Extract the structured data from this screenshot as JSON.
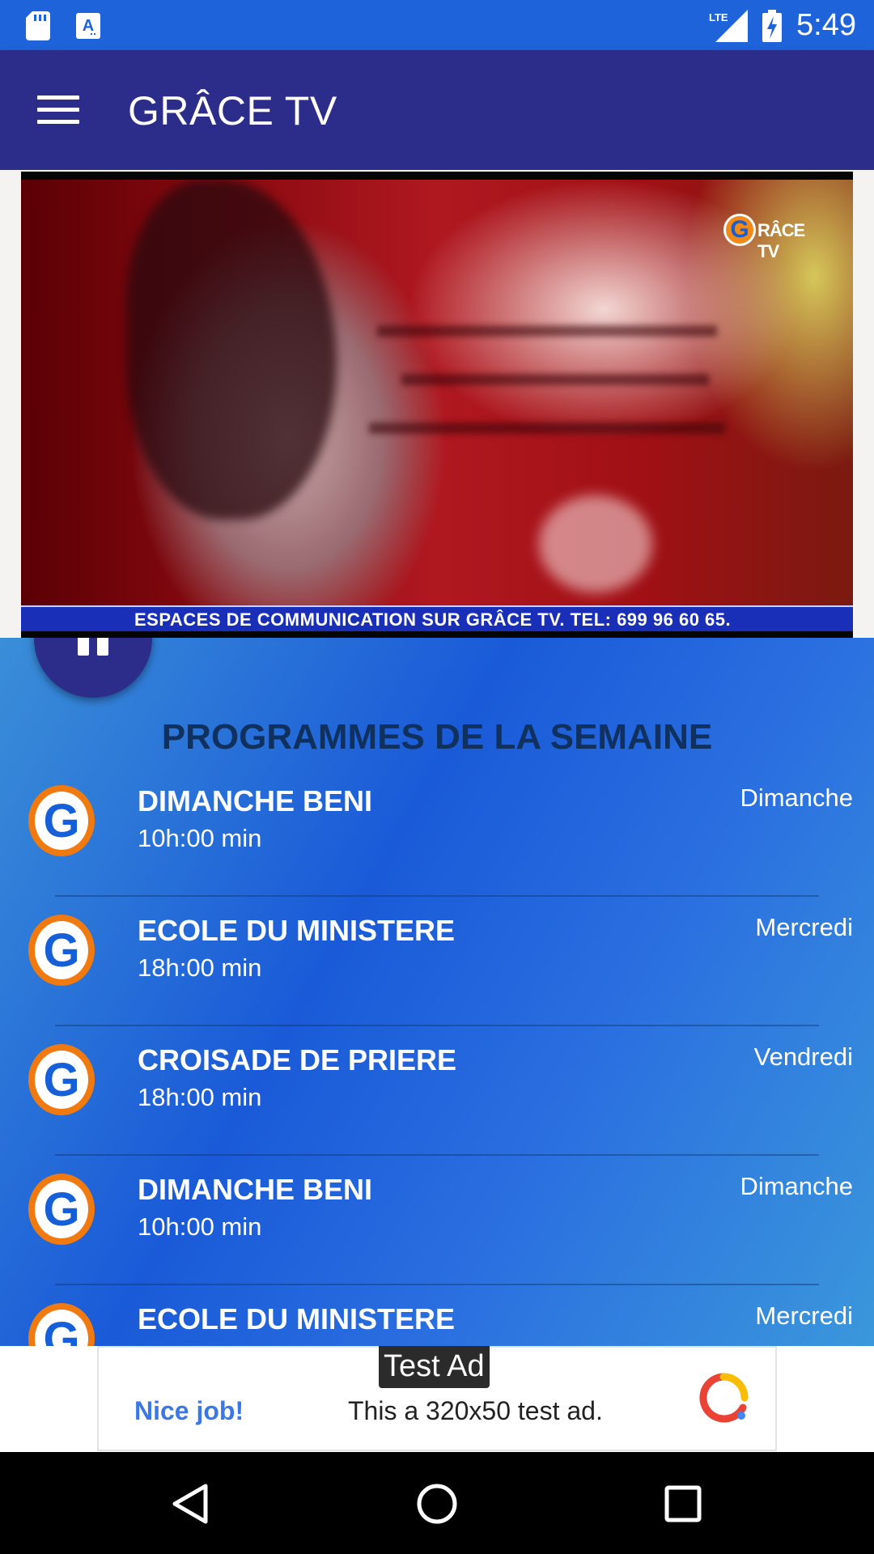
{
  "status_bar": {
    "time": "5:49",
    "network": "LTE",
    "icons": [
      "sd-card-icon",
      "a-notification-icon",
      "lte-signal-icon",
      "battery-charging-icon"
    ]
  },
  "app_bar": {
    "title": "GRÂCE TV",
    "menu_icon": "hamburger-menu-icon"
  },
  "player": {
    "channel_logo_text": "RÂCE TV",
    "ticker_text": "ESPACES DE COMMUNICATION SUR GRÂCE TV. TEL: 699 96 60 65.",
    "state": "playing",
    "control_icon": "pause-icon"
  },
  "programs": {
    "title": "PROGRAMMES DE LA SEMAINE",
    "items": [
      {
        "name": "DIMANCHE BENI",
        "time": "10h:00 min",
        "day": "Dimanche"
      },
      {
        "name": "ECOLE DU MINISTERE",
        "time": "18h:00 min",
        "day": "Mercredi"
      },
      {
        "name": "CROISADE DE PRIERE",
        "time": "18h:00 min",
        "day": "Vendredi"
      },
      {
        "name": "DIMANCHE BENI",
        "time": "10h:00 min",
        "day": "Dimanche"
      },
      {
        "name": "ECOLE DU MINISTERE",
        "time": "",
        "day": "Mercredi"
      }
    ]
  },
  "ad": {
    "label": "Test Ad",
    "headline": "Nice job!",
    "body": "This a 320x50 test ad."
  },
  "colors": {
    "status_bar": "#1E63D9",
    "app_bar": "#2C2C8A",
    "accent_text": "#10305e"
  }
}
